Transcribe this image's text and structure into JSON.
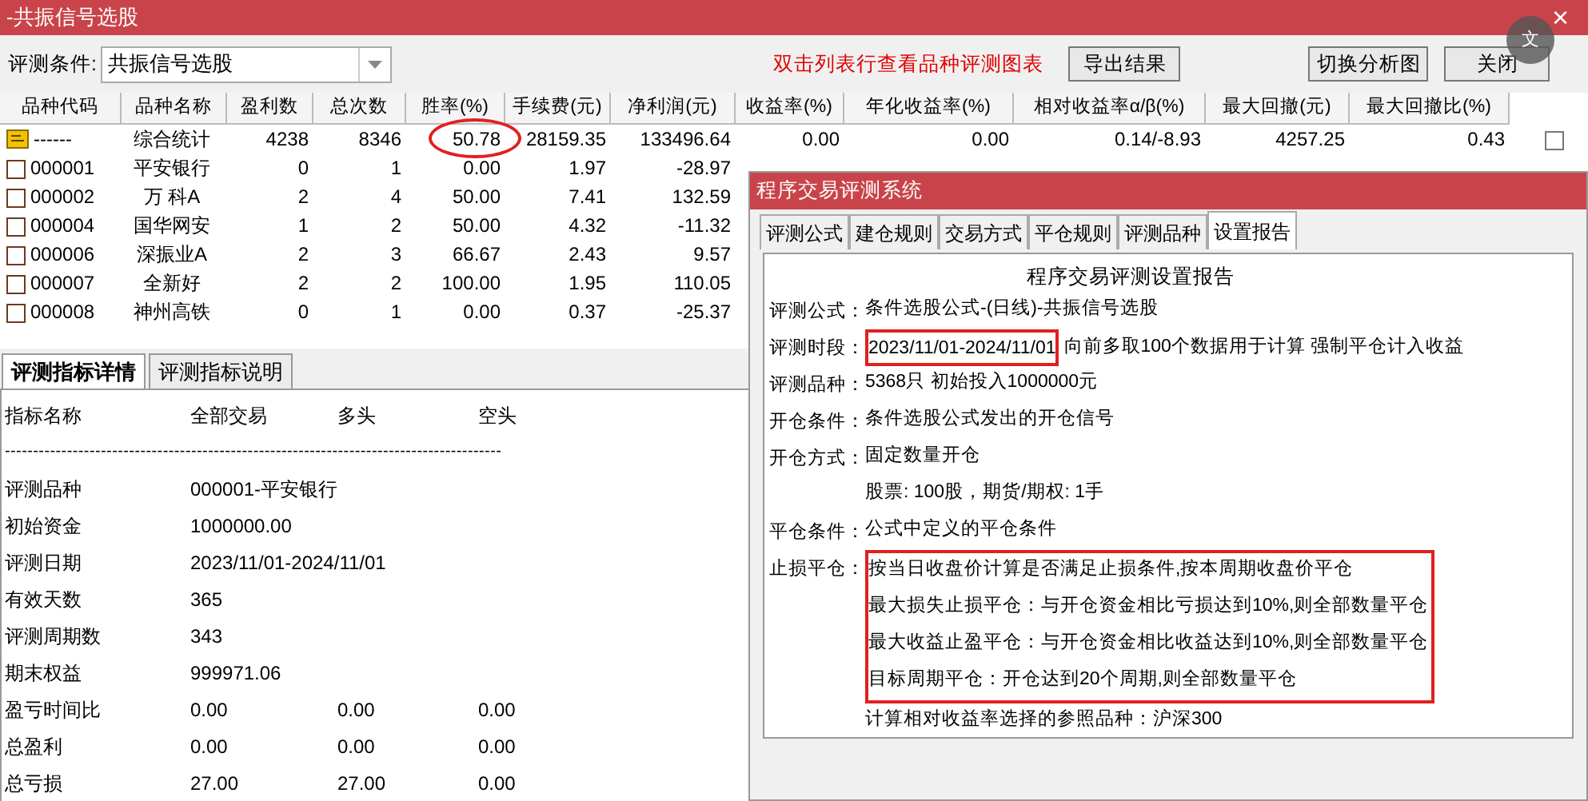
{
  "window": {
    "title": "-共振信号选股",
    "close": "×",
    "translate": "文"
  },
  "toolbar": {
    "condition_label": "评测条件:",
    "condition_value": "共振信号选股",
    "hint": "双击列表行查看品种评测图表",
    "buttons": [
      "导出结果",
      "切换分析图",
      "关闭"
    ]
  },
  "table": {
    "columns": [
      "品种代码",
      "品种名称",
      "盈利数",
      "总次数",
      "胜率(%)",
      "手续费(元)",
      "净利润(元)",
      "收益率(%)",
      "年化收益率(%)",
      "相对收益率α/β(%)",
      "最大回撤(元)",
      "最大回撤比(%)"
    ],
    "select_all": {
      "checked": false
    },
    "rows": [
      {
        "kind": "summary",
        "circled": true,
        "cells": [
          "------",
          "综合统计",
          "4238",
          "8346",
          "50.78",
          "28159.35",
          "133496.64",
          "0.00",
          "0.00",
          "0.14/-8.93",
          "4257.25",
          "0.43"
        ]
      },
      {
        "kind": "stock",
        "circled": false,
        "cells": [
          "000001",
          "平安银行",
          "0",
          "1",
          "0.00",
          "1.97",
          "-28.97"
        ]
      },
      {
        "kind": "stock",
        "circled": false,
        "cells": [
          "000002",
          "万 科A",
          "2",
          "4",
          "50.00",
          "7.41",
          "132.59"
        ]
      },
      {
        "kind": "stock",
        "circled": false,
        "cells": [
          "000004",
          "国华网安",
          "1",
          "2",
          "50.00",
          "4.32",
          "-11.32"
        ]
      },
      {
        "kind": "stock",
        "circled": false,
        "cells": [
          "000006",
          "深振业A",
          "2",
          "3",
          "66.67",
          "2.43",
          "9.57"
        ]
      },
      {
        "kind": "stock",
        "circled": false,
        "cells": [
          "000007",
          "全新好",
          "2",
          "2",
          "100.00",
          "1.95",
          "110.05"
        ]
      },
      {
        "kind": "stock",
        "circled": false,
        "cells": [
          "000008",
          "神州高铁",
          "0",
          "1",
          "0.00",
          "0.37",
          "-25.37"
        ]
      }
    ]
  },
  "detail_tabs": [
    {
      "label": "评测指标详情",
      "selected": true
    },
    {
      "label": "评测指标说明",
      "selected": false
    }
  ],
  "details": {
    "header": [
      "指标名称",
      "全部交易",
      "多头",
      "空头"
    ],
    "separator": "----------------------------------------------------------------------------------------",
    "rows": [
      {
        "label": "评测品种",
        "values": [
          "000001-平安银行"
        ]
      },
      {
        "label": "初始资金",
        "values": [
          "1000000.00"
        ]
      },
      {
        "label": "评测日期",
        "values": [
          "2023/11/01-2024/11/01"
        ]
      },
      {
        "label": "有效天数",
        "values": [
          "365"
        ]
      },
      {
        "label": "评测周期数",
        "values": [
          "343"
        ]
      },
      {
        "label": "期末权益",
        "values": [
          "999971.06"
        ]
      },
      {
        "label": "盈亏时间比",
        "values": [
          "0.00",
          "0.00",
          "0.00"
        ]
      },
      {
        "label": "总盈利",
        "values": [
          "0.00",
          "0.00",
          "0.00"
        ]
      },
      {
        "label": "总亏损",
        "values": [
          "27.00",
          "27.00",
          "0.00"
        ]
      }
    ]
  },
  "dialog": {
    "title": "程序交易评测系统",
    "tabs": [
      {
        "label": "评测公式",
        "selected": false
      },
      {
        "label": "建仓规则",
        "selected": false
      },
      {
        "label": "交易方式",
        "selected": false
      },
      {
        "label": "平仓规则",
        "selected": false
      },
      {
        "label": "评测品种",
        "selected": false
      },
      {
        "label": "设置报告",
        "selected": true
      }
    ],
    "report": {
      "title": "程序交易评测设置报告",
      "lines": [
        {
          "label": "评测公式：",
          "text": "条件选股公式-(日线)-共振信号选股",
          "boxed": false
        },
        {
          "label": "评测时段：",
          "text": "2023/11/01-2024/11/01",
          "note": "向前多取100个数据用于计算 强制平仓计入收益",
          "boxed": true
        },
        {
          "label": "评测品种：",
          "text": "5368只 初始投入1000000元",
          "boxed": false
        },
        {
          "label": "开仓条件：",
          "text": "条件选股公式发出的开仓信号",
          "boxed": false
        },
        {
          "label": "开仓方式：",
          "text": "固定数量开仓",
          "boxed": false
        },
        {
          "text": "股票: 100股，期货/期权: 1手",
          "boxed": false
        },
        {
          "label": "平仓条件：",
          "text": "公式中定义的平仓条件",
          "boxed": false
        },
        {
          "label": "止损平仓：",
          "lines": [
            "按当日收盘价计算是否满足止损条件,按本周期收盘价平仓",
            "最大损失止损平仓：与开仓资金相比亏损达到10%,则全部数量平仓",
            "最大收益止盈平仓：与开仓资金相比收益达到10%,则全部数量平仓",
            "目标周期平仓：开仓达到20个周期,则全部数量平仓"
          ],
          "boxed": true
        },
        {
          "text": "计算相对收益率选择的参照品种：沪深300",
          "boxed": false
        }
      ]
    }
  }
}
